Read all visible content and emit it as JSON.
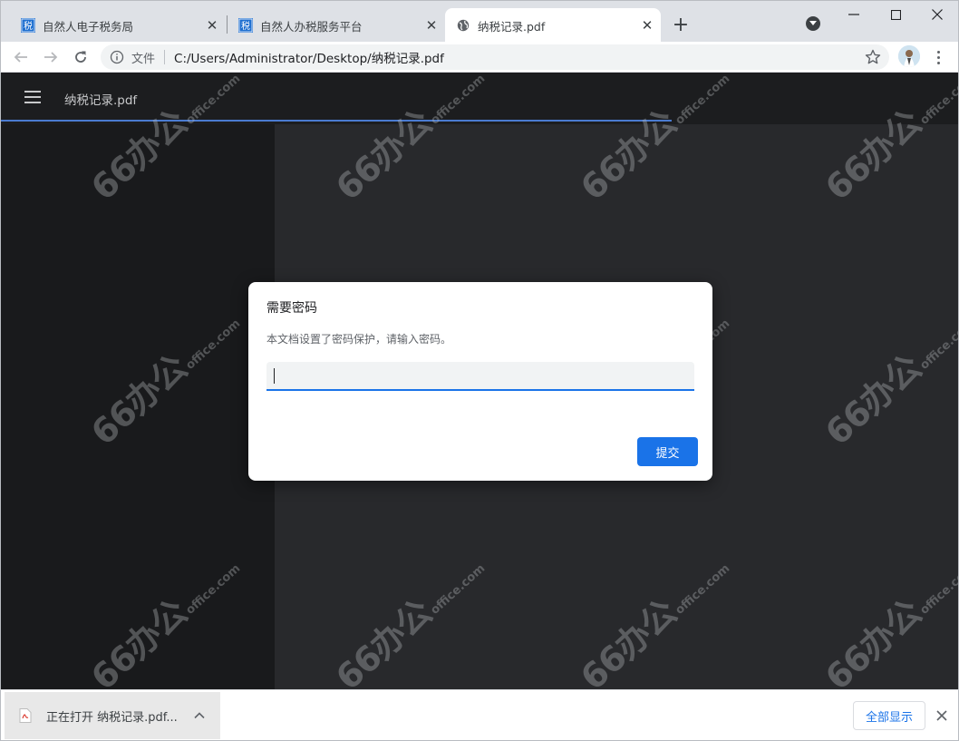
{
  "tabs": [
    {
      "title": "自然人电子税务局",
      "favicon": "tax-bureau-icon",
      "active": false
    },
    {
      "title": "自然人办税服务平台",
      "favicon": "tax-bureau-icon",
      "active": false
    },
    {
      "title": "纳税记录.pdf",
      "favicon": "globe-icon",
      "active": true
    }
  ],
  "tab_favicon_text": "税",
  "addressbar": {
    "scheme_label": "文件",
    "url": "C:/Users/Administrator/Desktop/纳税记录.pdf"
  },
  "pdf_viewer": {
    "title": "纳税记录.pdf"
  },
  "watermark": {
    "big": "66办公",
    "small": "office.com"
  },
  "password_dialog": {
    "title": "需要密码",
    "message": "本文档设置了密码保护，请输入密码。",
    "input_value": "",
    "submit_label": "提交"
  },
  "download_shelf": {
    "item_label": "正在打开 纳税记录.pdf...",
    "show_all_label": "全部显示"
  },
  "colors": {
    "accent": "#1a73e8",
    "viewer_bg": "#28292c",
    "sidebar_bg": "#191a1c"
  }
}
